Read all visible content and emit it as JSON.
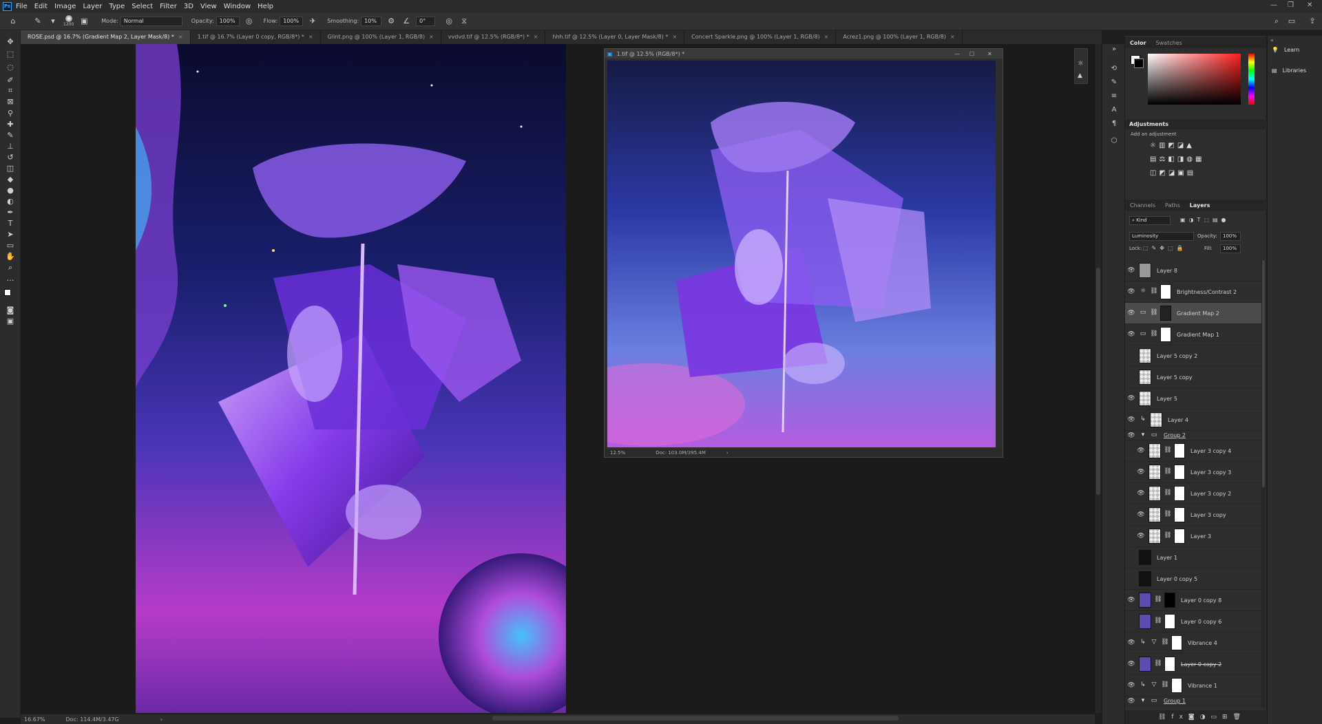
{
  "menubar": {
    "logo": "Ps",
    "items": [
      "File",
      "Edit",
      "Image",
      "Layer",
      "Type",
      "Select",
      "Filter",
      "3D",
      "View",
      "Window",
      "Help"
    ]
  },
  "options": {
    "brush_size": "1200",
    "mode_label": "Mode:",
    "mode_value": "Normal",
    "opacity_label": "Opacity:",
    "opacity_value": "100%",
    "flow_label": "Flow:",
    "flow_value": "100%",
    "smoothing_label": "Smoothing:",
    "smoothing_value": "10%",
    "angle_value": "0°"
  },
  "tabs": [
    {
      "label": "ROSE.psd @ 16.7% (Gradient Map 2, Layer Mask/8) *"
    },
    {
      "label": "1.tif @ 16.7% (Layer 0 copy, RGB/8*) *"
    },
    {
      "label": "Glint.png @ 100% (Layer 1, RGB/8)"
    },
    {
      "label": "vvdvd.tif @ 12.5% (RGB/8*) *"
    },
    {
      "label": "hhh.tif @ 12.5% (Layer 0, Layer Mask/8) *"
    },
    {
      "label": "Concert Sparkle.png @ 100% (Layer 1, RGB/8)"
    },
    {
      "label": "Acrez1.png @ 100% (Layer 1, RGB/8)"
    }
  ],
  "float_window": {
    "title": "1.tif @ 12.5% (RGB/8*) *",
    "zoom": "12.5%",
    "doc": "Doc: 103.0M/395.4M"
  },
  "statusbar": {
    "zoom": "16.67%",
    "doc": "Doc: 114.4M/3.47G"
  },
  "color_panel": {
    "tabs": [
      "Color",
      "Swatches"
    ]
  },
  "adjustments": {
    "title": "Adjustments",
    "hint": "Add an adjustment"
  },
  "layers_panel": {
    "tabs": [
      "Channels",
      "Paths",
      "Layers"
    ],
    "filter_kind": "Kind",
    "blend_mode": "Luminosity",
    "opacity_label": "Opacity:",
    "opacity_value": "100%",
    "lock_label": "Lock:",
    "fill_label": "Fill:",
    "fill_value": "100%",
    "layers": [
      {
        "name": "Layer 8",
        "visible": true
      },
      {
        "name": "Brightness/Contrast 2",
        "visible": true
      },
      {
        "name": "Gradient Map 2",
        "visible": true
      },
      {
        "name": "Gradient Map 1",
        "visible": true
      },
      {
        "name": "Layer 5 copy 2",
        "visible": false
      },
      {
        "name": "Layer 5 copy",
        "visible": false
      },
      {
        "name": "Layer 5",
        "visible": true
      },
      {
        "name": "Layer 4",
        "visible": true
      },
      {
        "name": "Group 2",
        "visible": true
      },
      {
        "name": "Layer 3 copy 4",
        "visible": true
      },
      {
        "name": "Layer 3 copy 3",
        "visible": true
      },
      {
        "name": "Layer 3 copy 2",
        "visible": true
      },
      {
        "name": "Layer 3 copy",
        "visible": true
      },
      {
        "name": "Layer 3",
        "visible": true
      },
      {
        "name": "Layer 1",
        "visible": false
      },
      {
        "name": "Layer 0 copy 5",
        "visible": false
      },
      {
        "name": "Layer 0 copy 8",
        "visible": true
      },
      {
        "name": "Layer 0 copy 6",
        "visible": false
      },
      {
        "name": "Vibrance 4",
        "visible": true
      },
      {
        "name": "Layer 0 copy 2",
        "visible": true
      },
      {
        "name": "Vibrance 1",
        "visible": true
      },
      {
        "name": "Group 1",
        "visible": true
      }
    ]
  },
  "right_panel": {
    "learn": "Learn",
    "libraries": "Libraries"
  }
}
